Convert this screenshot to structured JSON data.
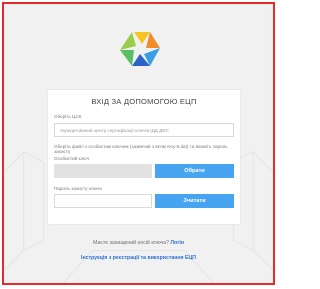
{
  "card": {
    "title": "ВХІД ЗА ДОПОМОГОЮ ЕЦП",
    "ca_label": "Оберіть ЦСК",
    "ca_value": "Акредитований центр сертифікації ключів ІДД ДФС",
    "file_label": "Оберіть файл з особистим ключем (зазвичай з ім'ям Key-6.dat) та вкажіть пароль захисту",
    "key_label": "Особистий ключ",
    "select_button": "Обрати",
    "password_label": "Пароль захисту ключа",
    "read_button": "Зчитати"
  },
  "footer": {
    "protected_media_text": "Маєте захищений носій ключа?",
    "login_link": "Логін",
    "instructions_link": "Інструкція з реєстрації та використання ЕЦП"
  },
  "colors": {
    "accent": "#46a4f1",
    "link": "#2e6fd6",
    "frame": "#e32b2b"
  }
}
